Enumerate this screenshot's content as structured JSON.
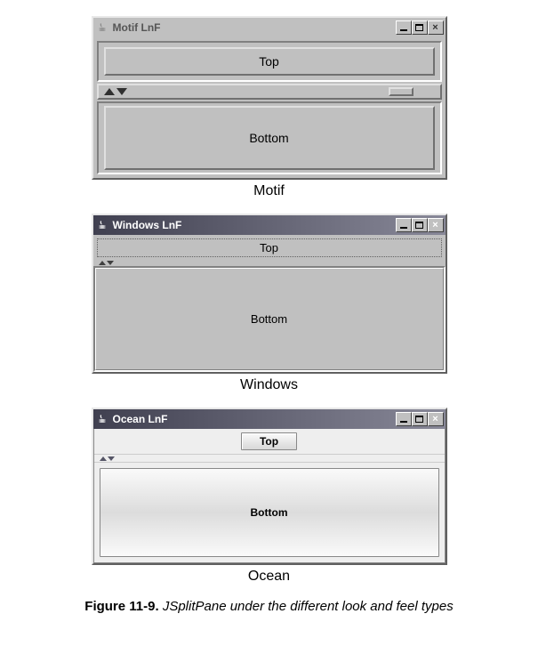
{
  "motif": {
    "title": "Motif LnF",
    "top_label": "Top",
    "bottom_label": "Bottom",
    "caption": "Motif"
  },
  "windows": {
    "title": "Windows LnF",
    "top_label": "Top",
    "bottom_label": "Bottom",
    "caption": "Windows"
  },
  "ocean": {
    "title": "Ocean LnF",
    "top_label": "Top",
    "bottom_label": "Bottom",
    "caption": "Ocean"
  },
  "window_controls": {
    "minimize": "_",
    "maximize": "□",
    "close": "×"
  },
  "figure": {
    "number": "Figure 11-9.",
    "text": "JSplitPane under the different look and feel types"
  }
}
